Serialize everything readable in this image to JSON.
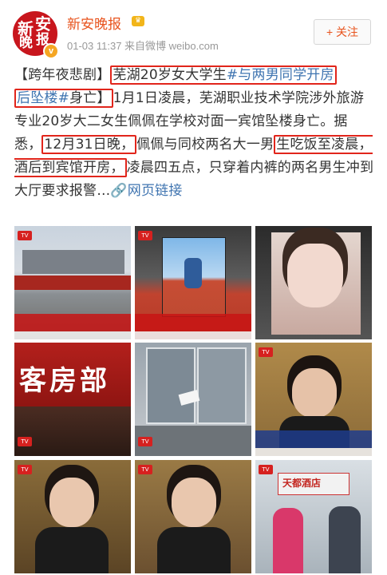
{
  "header": {
    "account_name": "新安晚报",
    "vip_badge": "v",
    "avatar_chars": [
      "新",
      "安",
      "晚",
      "报"
    ],
    "meta": "01-03 11:37  来自微博 weibo.com",
    "follow_label": "+ 关注"
  },
  "post": {
    "t1": "【",
    "t2": "跨年夜悲剧",
    "t3": "】",
    "t4": "芜湖20岁女大学生",
    "t5": "#与两男同学开房",
    "t6": "后坠楼#",
    "t7": "身亡",
    "t8": "】",
    "t9": "1月1日凌晨，芜湖职业技术学院涉外旅游专业20岁大二女生佩佩在学校对面一宾馆坠楼身亡。据悉，",
    "t10": "12月31日晚，",
    "t11": "佩佩与同校两名大一男",
    "t12": "生吃饭至凌晨，酒后到宾馆开房，",
    "t13": "凌晨四五点，只穿着内裤的两名男生冲到大厅要求报警…",
    "t14": "网页链接"
  },
  "photos": {
    "p3_sign": "客房部",
    "p9_sign": "天都酒店"
  },
  "colors": {
    "accent": "#e8541e",
    "link": "#3f74b0",
    "highlight_box": "#e1251b"
  }
}
